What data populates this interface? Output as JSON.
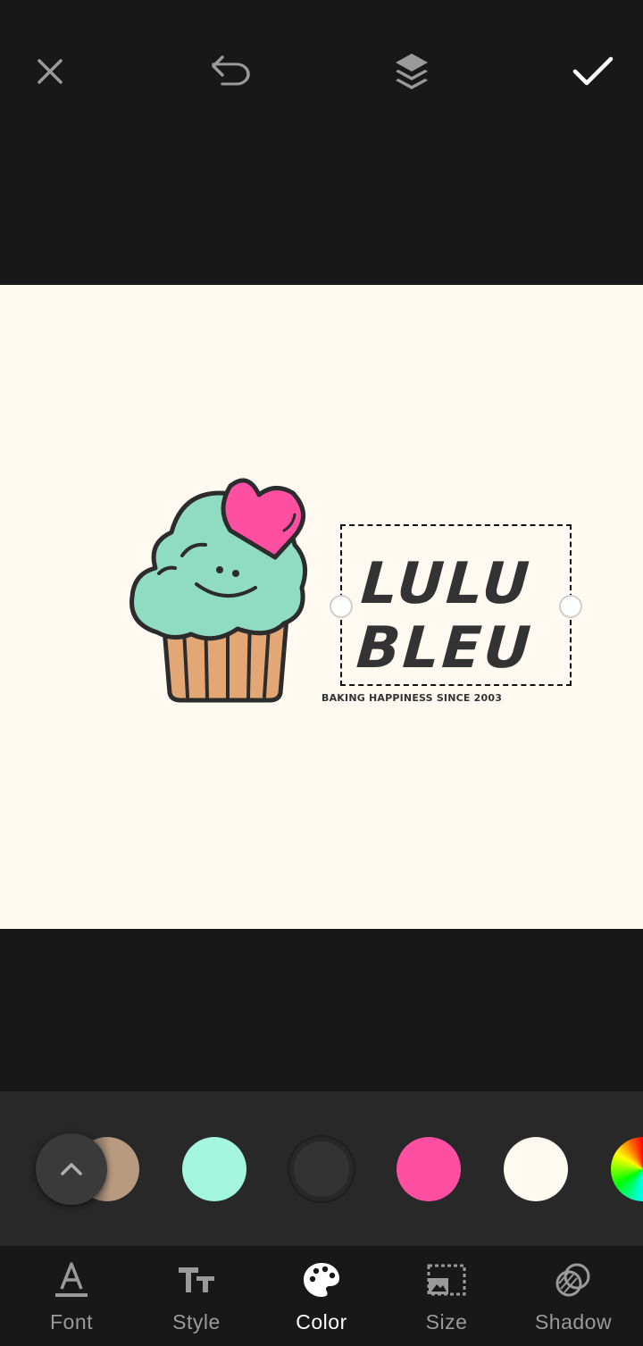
{
  "colors": {
    "background": "#181818",
    "canvas": "#fff9f2",
    "strip": "#282828",
    "active_label": "#ffffff",
    "inactive_label": "#9a9a9a"
  },
  "top_bar": {
    "icons": [
      "close-icon",
      "undo-icon",
      "layers-icon",
      "check-icon"
    ]
  },
  "canvas": {
    "title_line1": "LULU",
    "title_line2": "BLEU",
    "tagline": "BAKING HAPPINESS SINCE 2003"
  },
  "palette": {
    "swatches": [
      {
        "name": "tan-brown",
        "color": "#b89a80"
      },
      {
        "name": "mint",
        "color": "#a3f5dc"
      },
      {
        "name": "charcoal",
        "color": "#333333",
        "selected": true
      },
      {
        "name": "pink",
        "color": "#ff4fa3"
      },
      {
        "name": "cream",
        "color": "#fff9f2"
      },
      {
        "name": "color-picker",
        "color": "rainbow"
      }
    ]
  },
  "tabs": [
    {
      "label": "Font",
      "icon": "font-icon"
    },
    {
      "label": "Style",
      "icon": "text-style-icon"
    },
    {
      "label": "Color",
      "icon": "palette-icon",
      "active": true
    },
    {
      "label": "Size",
      "icon": "resize-icon"
    },
    {
      "label": "Shadow",
      "icon": "shadow-icon"
    }
  ]
}
